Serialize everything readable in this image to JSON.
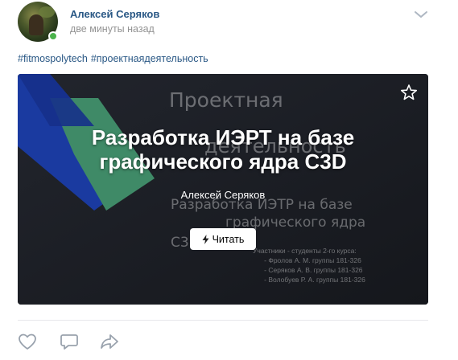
{
  "post": {
    "author": "Алексей Серяков",
    "time": "две минуты назад",
    "online": true,
    "hashtags": [
      "#fitmospolytech",
      "#проектнаядеятельность"
    ]
  },
  "article": {
    "title": "Разработка ИЭРТ на базе графического ядра C3D",
    "author": "Алексей Серяков",
    "read_label": "Читать",
    "cover_text": {
      "line1": "Проектная",
      "line2": "деятельность",
      "line3": "Разработка ИЭТР на базе",
      "line4": "графического ядра",
      "line5": "C3D",
      "participants": "Участники - студенты 2-го курса:\n      - Фролов А. М. группы 181-326\n      - Серяков А. В. группы 181-326\n      - Волобуев Р. А. группы 181-326"
    }
  },
  "icons": {
    "menu": "chevron-down-icon",
    "bookmark": "star-icon",
    "read": "lightning-icon",
    "like": "heart-icon",
    "comment": "comment-icon",
    "share": "share-arrow-icon"
  },
  "colors": {
    "link": "#2a5885",
    "muted": "#939393",
    "online": "#4bb34b",
    "card_bg": "#1c1f26"
  }
}
